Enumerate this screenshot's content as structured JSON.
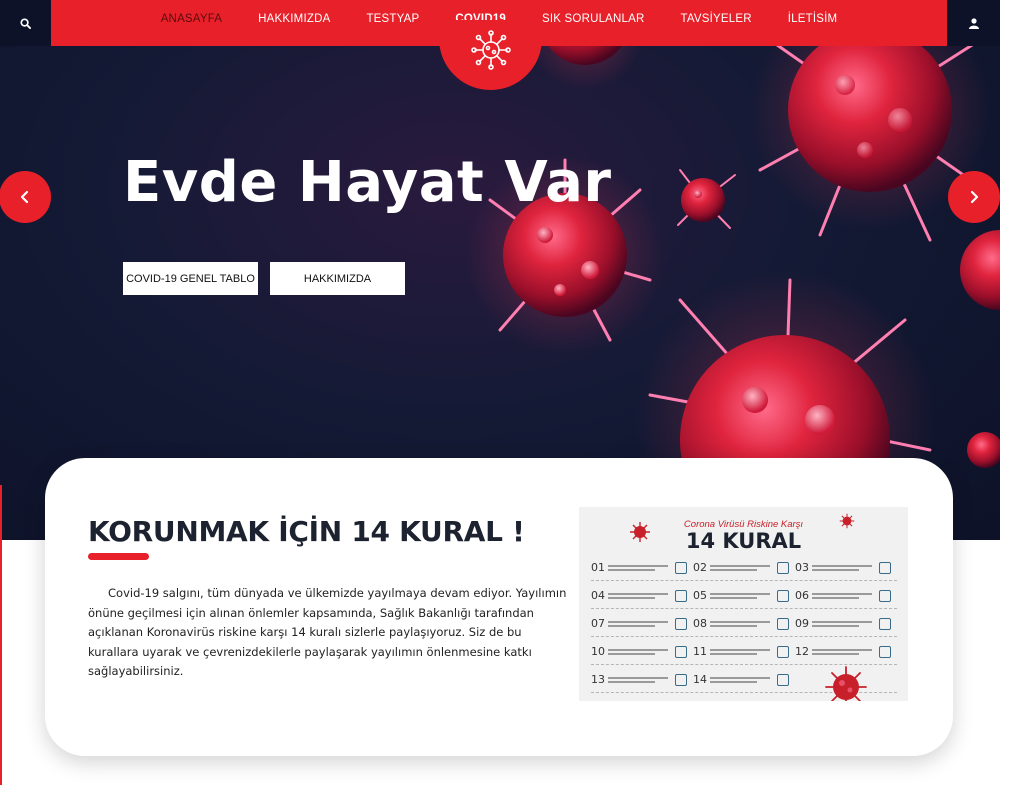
{
  "nav": {
    "items": [
      {
        "label": "ANASAYFA"
      },
      {
        "label": "HAKKIMIZDA"
      },
      {
        "label": "TESTYAP"
      },
      {
        "label": "COVID19"
      },
      {
        "label": "SIK SORULANLAR"
      },
      {
        "label": "TAVSİYELER"
      },
      {
        "label": "İLETİSİM"
      }
    ]
  },
  "hero": {
    "title": "Evde Hayat Var",
    "button1": "COVID-19 GENEL TABLO",
    "button2": "HAKKIMIZDA"
  },
  "card": {
    "title": "KORUNMAK İÇİN 14 KURAL !",
    "text": "Covid-19 salgını, tüm dünyada ve ülkemizde yayılmaya devam ediyor. Yayılımın önüne geçilmesi için alınan önlemler kapsamında, Sağlık Bakanlığı tarafından açıklanan Koronavirüs riskine karşı 14 kuralı sizlerle paylaşıyoruz. Siz de bu kurallara uyarak ve çevrenizdekilerle paylaşarak yayılımın önlenmesine katkı sağlayabilirsiniz."
  },
  "infographic": {
    "subtitle": "Corona Virüsü Riskine Karşı",
    "title": "14 KURAL",
    "numbers": [
      "01",
      "02",
      "03",
      "04",
      "05",
      "06",
      "07",
      "08",
      "09",
      "10",
      "11",
      "12",
      "13",
      "14"
    ]
  },
  "colors": {
    "accent": "#e8202a",
    "dark": "#0d1228",
    "title": "#1d2230"
  },
  "icons": {
    "search": "search-icon",
    "user": "user-icon",
    "prev": "chevron-left-icon",
    "next": "chevron-right-icon",
    "virus": "virus-icon"
  }
}
